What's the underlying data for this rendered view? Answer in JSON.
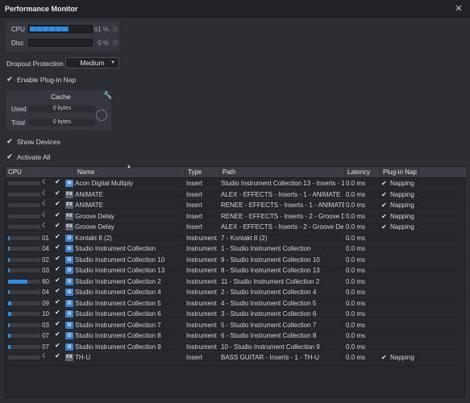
{
  "window": {
    "title": "Performance Monitor",
    "close_glyph": "✕"
  },
  "meters": [
    {
      "label": "CPU",
      "percent_text": "61 %",
      "level": 0.61
    },
    {
      "label": "Disc",
      "percent_text": "0 %",
      "level": 0.0
    }
  ],
  "dropout": {
    "label": "Dropout Protection",
    "value": "Medium"
  },
  "plugin_nap": {
    "label": "Enable Plug-in Nap",
    "checked": true
  },
  "cache": {
    "title": "Cache",
    "used_label": "Used",
    "used_value": "0 bytes",
    "total_label": "Total",
    "total_value": "0 bytes"
  },
  "show_devices": {
    "label": "Show Devices",
    "checked": true
  },
  "activate_all": {
    "label": "Activate All",
    "checked": true
  },
  "table": {
    "headers": {
      "cpu": "CPU",
      "name": "Name",
      "type": "Type",
      "path": "Path",
      "latency": "Latency",
      "nap": "Plug-in Nap"
    },
    "rows": [
      {
        "cpu": "",
        "cpu_level": 0.0,
        "napping_icon": true,
        "name": "Acon Digital Multiply",
        "icon": "plugin",
        "type": "Insert",
        "path": "Studio Instrument Collection 13 - Inserts - 1...",
        "latency": "0.0 ms",
        "nap": "Napping"
      },
      {
        "cpu": "",
        "cpu_level": 0.0,
        "napping_icon": true,
        "name": "ANIMATE",
        "icon": "fx",
        "type": "Insert",
        "path": "ALEX - EFFECTS - Inserts - 1 - ANIMATE",
        "latency": "0.0 ms",
        "nap": "Napping"
      },
      {
        "cpu": "",
        "cpu_level": 0.0,
        "napping_icon": true,
        "name": "ANIMATE",
        "icon": "fx",
        "type": "Insert",
        "path": "RENEE - EFFECTS - Inserts - 1 - ANIMATE",
        "latency": "0.0 ms",
        "nap": "Napping"
      },
      {
        "cpu": "",
        "cpu_level": 0.0,
        "napping_icon": true,
        "name": "Groove Delay",
        "icon": "fx",
        "type": "Insert",
        "path": "RENEE - EFFECTS - Inserts - 2 - Groove De...",
        "latency": "0.0 ms",
        "nap": "Napping"
      },
      {
        "cpu": "",
        "cpu_level": 0.0,
        "napping_icon": true,
        "name": "Groove Delay",
        "icon": "fx",
        "type": "Insert",
        "path": "ALEX - EFFECTS - Inserts - 2 - Groove Delay",
        "latency": "0.0 ms",
        "nap": "Napping"
      },
      {
        "cpu": "01",
        "cpu_level": 0.0,
        "napping_icon": false,
        "name": "Kontakt 8 (2)",
        "icon": "instrument",
        "type": "Instrument",
        "path": "7 - Kontakt 8 (2)",
        "latency": "0.0 ms",
        "nap": ""
      },
      {
        "cpu": "04",
        "cpu_level": 0.04,
        "napping_icon": false,
        "name": "Studio Instrument Collection",
        "icon": "instrument",
        "type": "Instrument",
        "path": "1 - Studio Instrument Collection",
        "latency": "0.0 ms",
        "nap": ""
      },
      {
        "cpu": "02",
        "cpu_level": 0.02,
        "napping_icon": false,
        "name": "Studio Instrument Collection 10",
        "icon": "instrument",
        "type": "Instrument",
        "path": "9 - Studio Instrument Collection 10",
        "latency": "0.0 ms",
        "nap": ""
      },
      {
        "cpu": "03",
        "cpu_level": 0.03,
        "napping_icon": false,
        "name": "Studio Instrument Collection 13",
        "icon": "instrument",
        "type": "Instrument",
        "path": "8 - Studio Instrument Collection 13",
        "latency": "0.0 ms",
        "nap": ""
      },
      {
        "cpu": "60",
        "cpu_level": 0.6,
        "napping_icon": false,
        "name": "Studio Instrument Collection 2",
        "icon": "instrument",
        "type": "Instrument",
        "path": "11 - Studio Instrument Collection 2",
        "latency": "0.0 ms",
        "nap": ""
      },
      {
        "cpu": "04",
        "cpu_level": 0.04,
        "napping_icon": false,
        "name": "Studio Instrument Collection 4",
        "icon": "instrument",
        "type": "Instrument",
        "path": "2 - Studio Instrument Collection 4",
        "latency": "0.0 ms",
        "nap": ""
      },
      {
        "cpu": "09",
        "cpu_level": 0.09,
        "napping_icon": false,
        "name": "Studio Instrument Collection 5",
        "icon": "instrument",
        "type": "Instrument",
        "path": "4 - Studio Instrument Collection 5",
        "latency": "0.0 ms",
        "nap": ""
      },
      {
        "cpu": "10",
        "cpu_level": 0.1,
        "napping_icon": false,
        "name": "Studio Instrument Collection 6",
        "icon": "instrument",
        "type": "Instrument",
        "path": "3 - Studio Instrument Collection 6",
        "latency": "0.0 ms",
        "nap": ""
      },
      {
        "cpu": "03",
        "cpu_level": 0.03,
        "napping_icon": false,
        "name": "Studio Instrument Collection 7",
        "icon": "instrument",
        "type": "Instrument",
        "path": "5 - Studio Instrument Collection 7",
        "latency": "0.0 ms",
        "nap": ""
      },
      {
        "cpu": "07",
        "cpu_level": 0.07,
        "napping_icon": false,
        "name": "Studio Instrument Collection 8",
        "icon": "instrument",
        "type": "Instrument",
        "path": "6 - Studio Instrument Collection 8",
        "latency": "0.0 ms",
        "nap": ""
      },
      {
        "cpu": "07",
        "cpu_level": 0.07,
        "napping_icon": false,
        "name": "Studio Instrument Collection 9",
        "icon": "instrument",
        "type": "Instrument",
        "path": "10 - Studio Instrument Collection 9",
        "latency": "0.0 ms",
        "nap": ""
      },
      {
        "cpu": "",
        "cpu_level": 0.0,
        "napping_icon": true,
        "name": "TH-U",
        "icon": "fx",
        "type": "Insert",
        "path": "BASS GUITAR - Inserts - 1 - TH-U",
        "latency": "0.0 ms",
        "nap": "Napping"
      }
    ]
  },
  "colors": {
    "accent": "#2f8de4",
    "background": "#2b2e33",
    "table_bg": "#24272b",
    "header_bg": "#3a3e44"
  }
}
